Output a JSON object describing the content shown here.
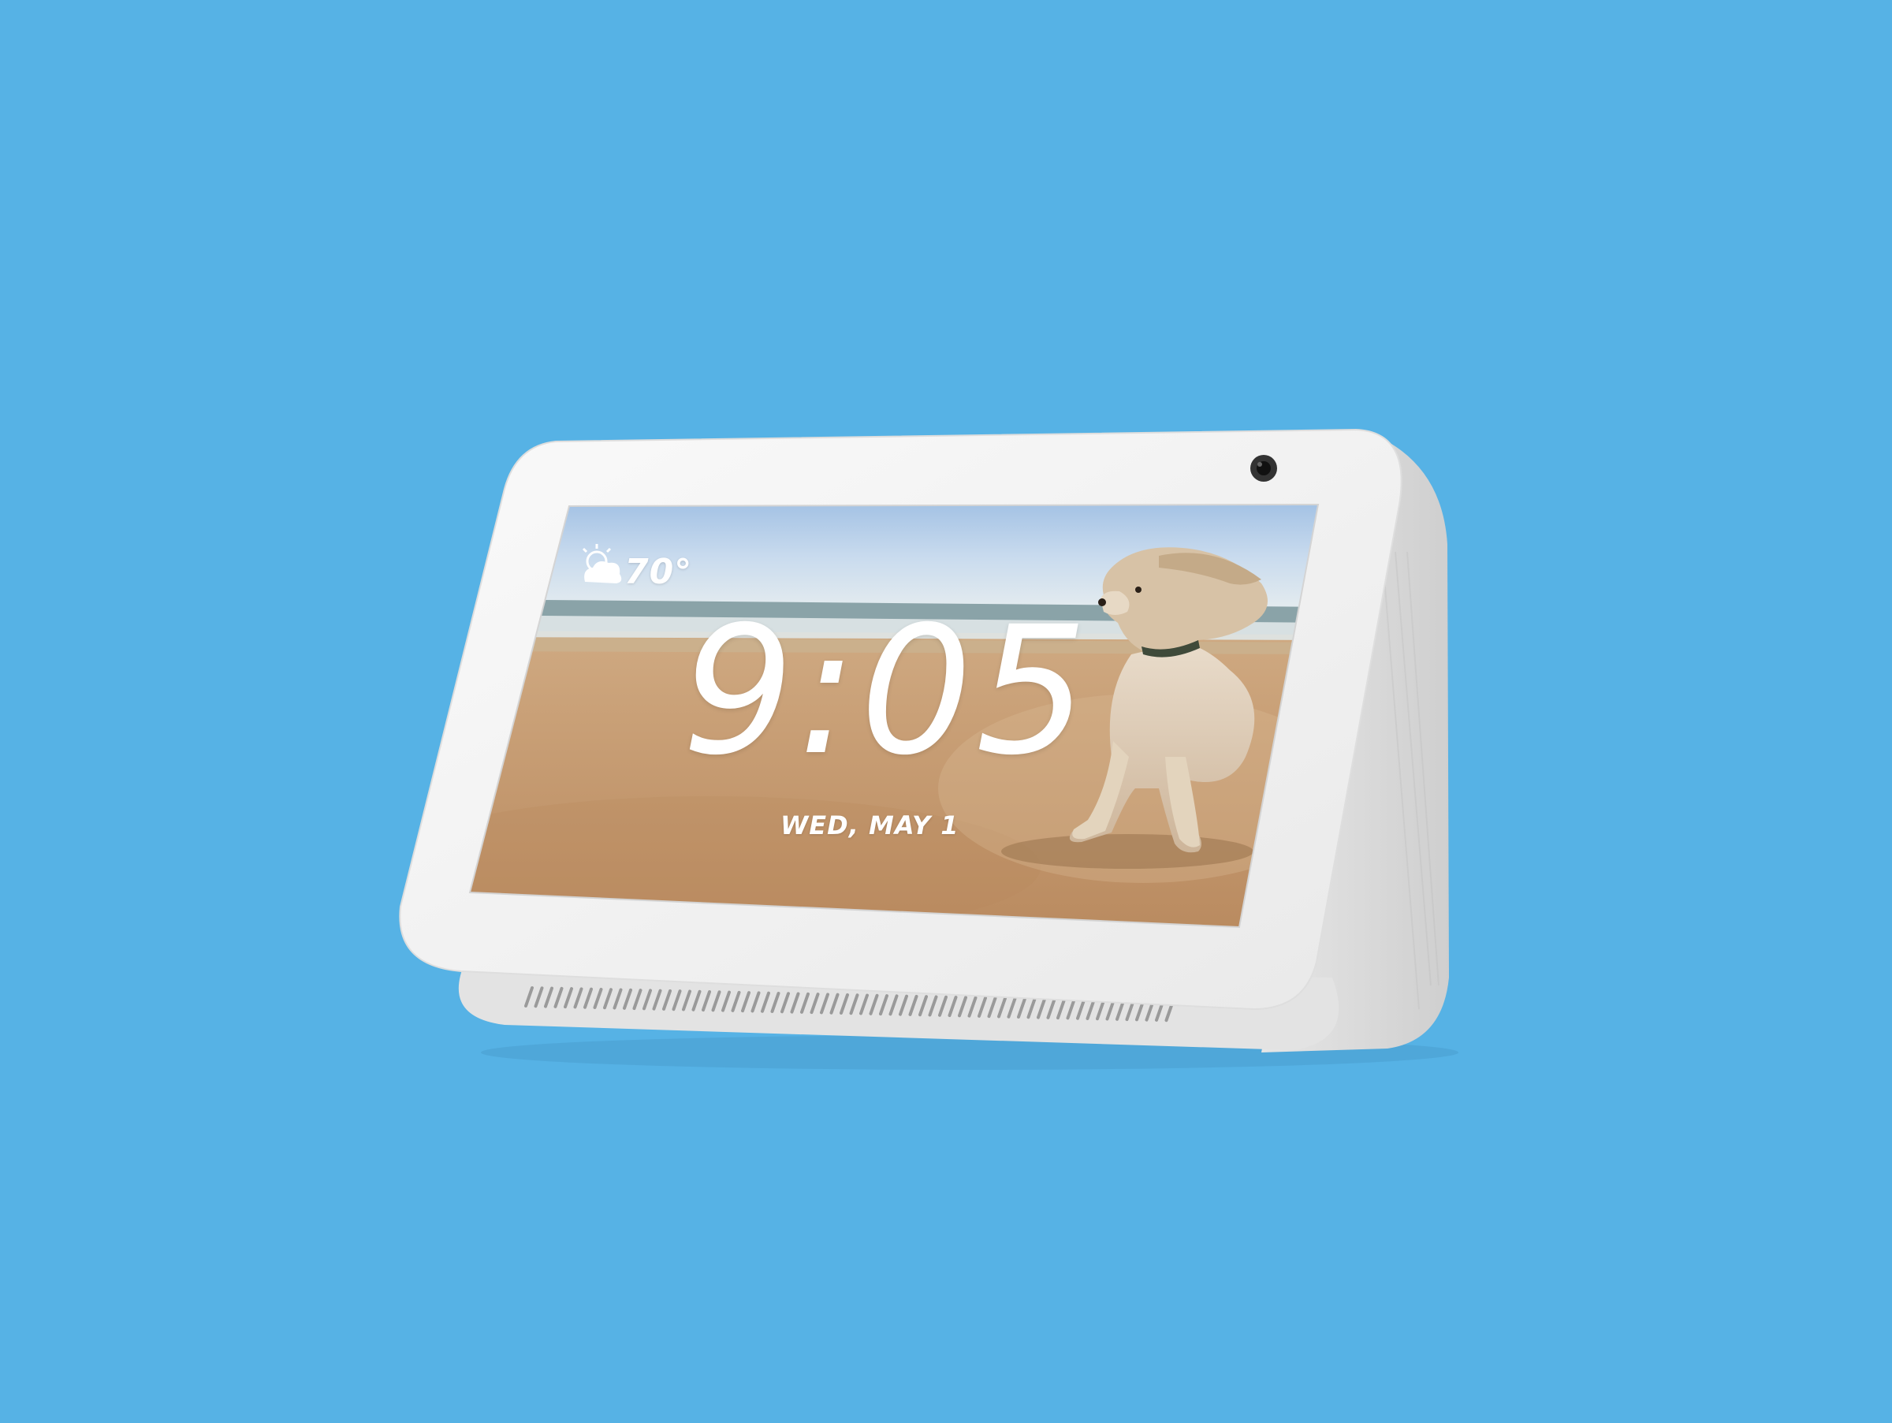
{
  "device": {
    "name_icon": "echo-show-5-device",
    "body_color": "#f4f4f4",
    "background_color": "#56b2e5"
  },
  "screen": {
    "weather": {
      "icon": "partly-cloudy-icon",
      "temperature": "70°"
    },
    "clock": {
      "time": "9:05",
      "date": "WED, MAY 1"
    },
    "wallpaper": {
      "subject": "dog-on-beach-photo"
    }
  }
}
